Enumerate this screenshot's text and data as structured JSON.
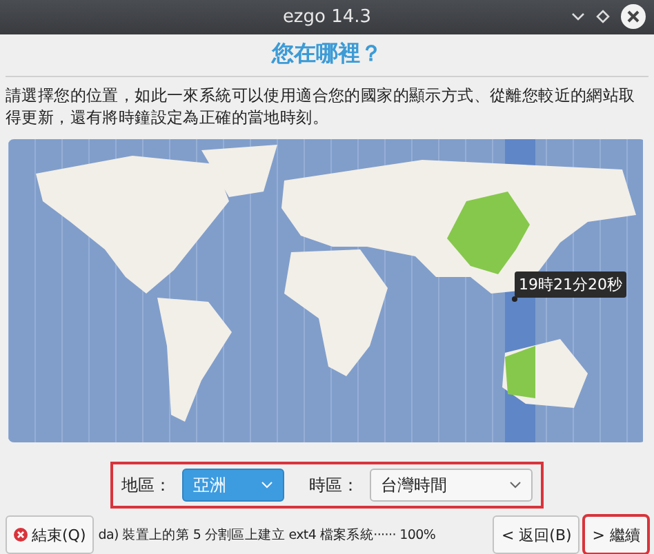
{
  "window": {
    "title": "ezgo 14.3"
  },
  "heading": "您在哪裡？",
  "description": "請選擇您的位置，如此一來系統可以使用適合您的國家的顯示方式、從離您較近的網站取得更新，還有將時鐘設定為正確的當地時刻。",
  "map": {
    "time_tooltip": "19時21分20秒"
  },
  "region": {
    "label": "地區：",
    "value": "亞洲"
  },
  "timezone": {
    "label": "時區：",
    "value": "台灣時間"
  },
  "footer": {
    "quit_button": "結束(Q)",
    "status": "da) 裝置上的第 5 分割區上建立 ext4 檔案系統······ 100%",
    "back_button": "< 返回(B)",
    "continue_button": "> 繼續"
  }
}
